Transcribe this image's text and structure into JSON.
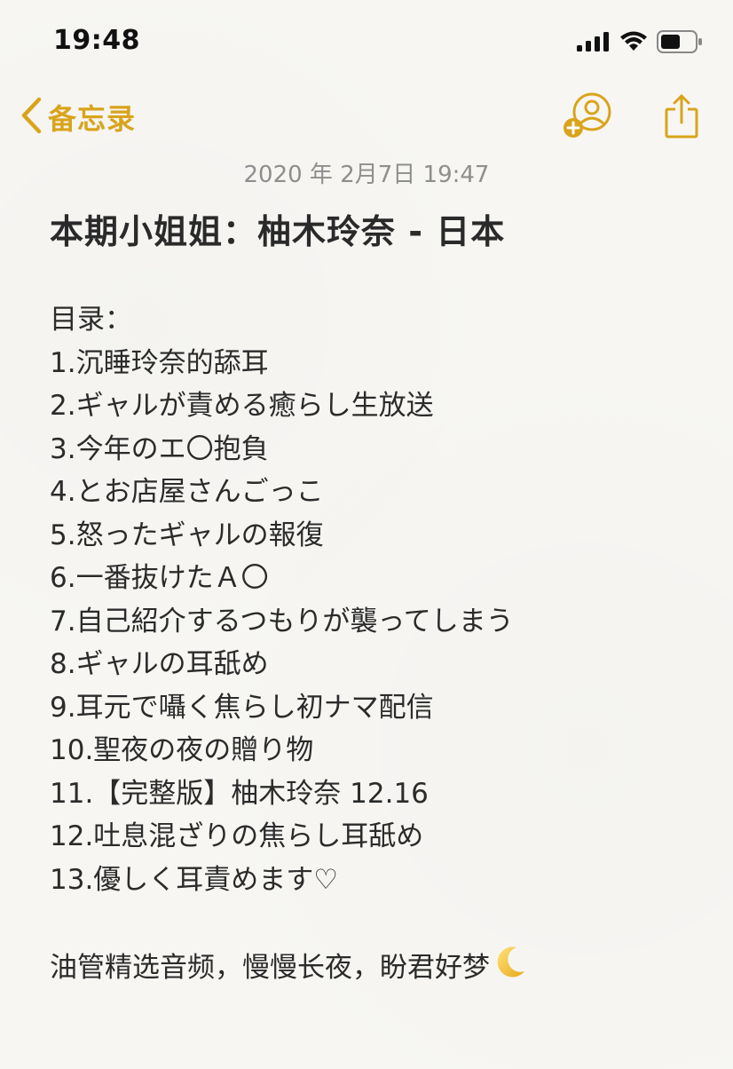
{
  "status_bar": {
    "time": "19:48"
  },
  "nav": {
    "back_label": "备忘录"
  },
  "note": {
    "date": "2020 年 2月7日 19:47",
    "title": "本期小姐姐：柚木玲奈 - 日本",
    "toc_heading": "目录：",
    "items": [
      "1.沉睡玲奈的舔耳",
      "2.ギャルが責める癒らし生放送",
      "3.今年のエ〇抱負",
      "4.とお店屋さんごっこ",
      "5.怒ったギャルの報復",
      "6.一番抜けたＡ〇",
      "7.自己紹介するつもりが襲ってしまう",
      "8.ギャルの耳舐め",
      "9.耳元で囁く焦らし初ナマ配信",
      "10.聖夜の夜の贈り物",
      "11.【完整版】柚木玲奈 12.16",
      "12.吐息混ざりの焦らし耳舐め",
      "13.優しく耳責めます♡"
    ],
    "closing": "油管精选音频，慢慢长夜，盼君好梦"
  },
  "colors": {
    "accent": "#d9a41c",
    "text": "#2b2b2b",
    "date": "#8e8e8e"
  },
  "icons": {
    "back": "chevron-left-icon",
    "add_person": "add-person-icon",
    "share": "share-icon",
    "moon": "crescent-moon-icon"
  }
}
